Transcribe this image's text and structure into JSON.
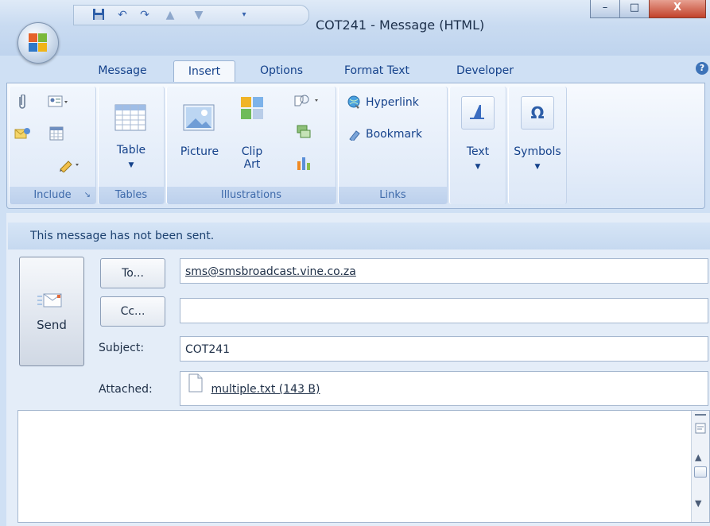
{
  "window": {
    "title": "COT241 - Message (HTML)",
    "minimize_glyph": "–",
    "maximize_glyph": "□",
    "close_glyph": "X"
  },
  "tabs": [
    "Message",
    "Insert",
    "Options",
    "Format Text",
    "Developer"
  ],
  "active_tab": "Insert",
  "help_glyph": "?",
  "ribbon": {
    "include": {
      "label": "Include"
    },
    "tables": {
      "table": "Table",
      "label": "Tables"
    },
    "illustrations": {
      "picture": "Picture",
      "clip": "Clip",
      "art": "Art",
      "label": "Illustrations"
    },
    "links": {
      "hyperlink": "Hyperlink",
      "bookmark": "Bookmark",
      "label": "Links"
    },
    "text": {
      "label": "Text"
    },
    "symbols": {
      "label": "Symbols",
      "glyph": "Ω"
    }
  },
  "info_bar": "This message has not been sent.",
  "compose": {
    "send_label": "Send",
    "to_label": "To...",
    "cc_label": "Cc...",
    "subject_label": "Subject:",
    "attached_label": "Attached:",
    "to_value": "sms@smsbroadcast.vine.co.za",
    "cc_value": "",
    "subject_value": "COT241",
    "attachment": "multiple.txt (143 B)"
  },
  "icons": {
    "send": "send-envelope-icon",
    "attach": "paperclip-icon",
    "table": "table-grid-icon",
    "picture": "picture-icon",
    "clip_art": "clip-art-icon",
    "hyperlink": "hyperlink-globe-icon",
    "bookmark": "bookmark-icon",
    "text": "text-icon",
    "attachment_file": "text-file-icon"
  },
  "colors": {
    "title_bar": "#c9dbf1",
    "ribbon": "#e6eefa",
    "info_bar": "#c6d9f0",
    "close_button": "#c2412a"
  }
}
